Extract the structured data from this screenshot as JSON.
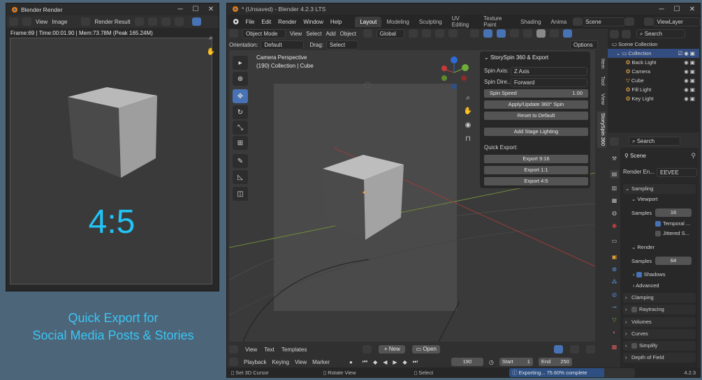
{
  "render_window": {
    "title": "Blender Render",
    "header": {
      "view": "View",
      "image": "Image",
      "result": "Render Result"
    },
    "stats": "Frame:69 | Time:00:01.90 | Mem:73.78M (Peak 165.24M)",
    "ratio": "4:5"
  },
  "promo": {
    "line1": "Quick Export for",
    "line2": "Social Media Posts & Stories"
  },
  "main_window": {
    "title": "* (Unsaved) - Blender 4.2.3 LTS",
    "menu": [
      "File",
      "Edit",
      "Render",
      "Window",
      "Help"
    ],
    "workspaces": [
      "Layout",
      "Modeling",
      "Sculpting",
      "UV Editing",
      "Texture Paint",
      "Shading",
      "Anima"
    ],
    "scene": "Scene",
    "view_layer": "ViewLayer",
    "header": {
      "mode": "Object Mode",
      "view": "View",
      "select": "Select",
      "add": "Add",
      "object": "Object",
      "orient": "Global"
    },
    "tool_settings": {
      "orientation_label": "Orientation:",
      "orientation": "Default",
      "drag_label": "Drag:",
      "drag": "Select Box",
      "options": "Options"
    },
    "viewport": {
      "line1": "Camera Perspective",
      "line2": "(190) Collection | Cube"
    },
    "sidebar_tabs": [
      "Item",
      "Tool",
      "View",
      "StorySpin 360"
    ],
    "storyspin": {
      "title": "StorySpin 360 & Export",
      "spin_axis_label": "Spin Axis:",
      "spin_axis": "Z Axis",
      "spin_dir_label": "Spin Dire...",
      "spin_dir": "Forward",
      "spin_speed_label": "Spin Speed",
      "spin_speed": "1.00",
      "apply": "Apply/Update 360° Spin",
      "reset": "Reset to Default",
      "lighting": "Add Stage Lighting",
      "quick_export": "Quick Export:",
      "exports": [
        "Export 9:16",
        "Export 1:1",
        "Export 4:5"
      ]
    },
    "outliner": {
      "search": "Search",
      "root": "Scene Collection",
      "collection": "Collection",
      "items": [
        "Back Light",
        "Camera",
        "Cube",
        "Fill Light",
        "Key Light"
      ]
    },
    "properties": {
      "search": "Search",
      "scene": "Scene",
      "engine_label": "Render En...",
      "engine": "EEVEE",
      "sampling": "Sampling",
      "viewport": "Viewport",
      "samples_label": "Samples",
      "viewport_samples": "16",
      "temporal": "Temporal ...",
      "jittered": "Jittered S...",
      "render": "Render",
      "render_samples": "64",
      "shadows": "Shadows",
      "advanced": "Advanced",
      "panels": [
        "Clamping",
        "Raytracing",
        "Volumes",
        "Curves",
        "Simplify",
        "Depth of Field"
      ]
    },
    "text_editor": {
      "view": "View",
      "text": "Text",
      "templates": "Templates",
      "new": "New",
      "open": "Open"
    },
    "timeline": {
      "playback": "Playback",
      "keying": "Keying",
      "view": "View",
      "marker": "Marker",
      "frame": "190",
      "start_label": "Start",
      "start": "1",
      "end_label": "End",
      "end": "250"
    },
    "status": {
      "cursor": "Set 3D Cursor",
      "rotate": "Rotate View",
      "select": "Select",
      "progress": "Exporting... 75.60% complete",
      "version": "4.2.3"
    }
  },
  "colors": {
    "accent": "#4772b3",
    "ratio_text": "#22c3f5",
    "promo_text": "#39c6f5",
    "desktop": "#4d6579"
  }
}
